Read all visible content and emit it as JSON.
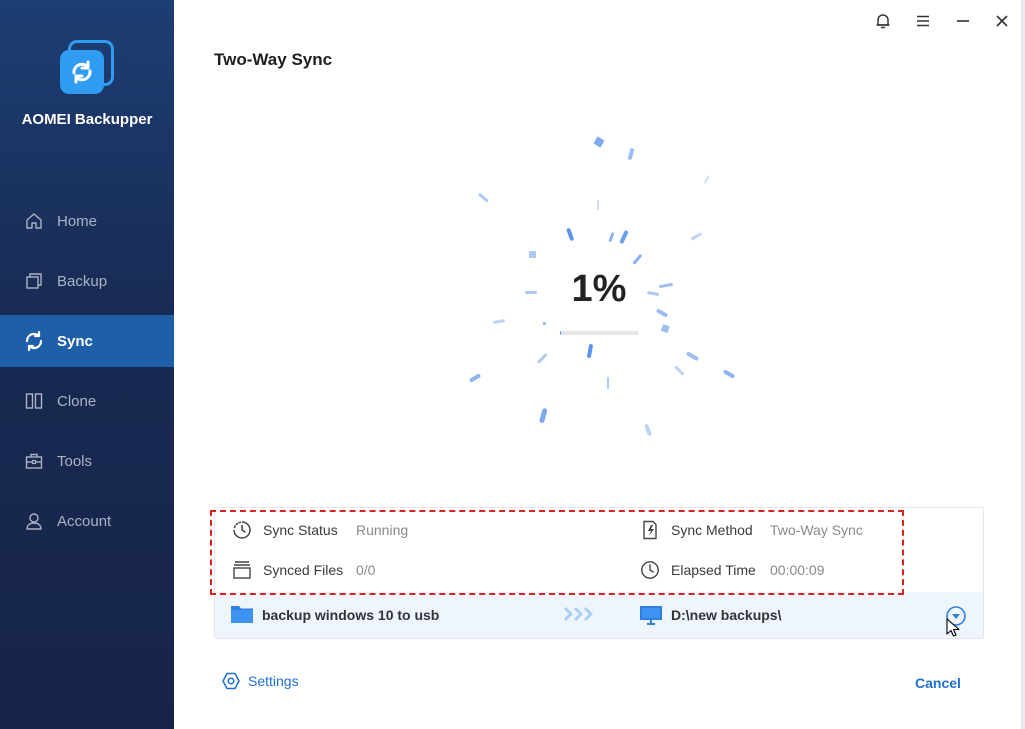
{
  "app": {
    "name": "AOMEI Backupper"
  },
  "sidebar": {
    "items": [
      {
        "label": "Home",
        "icon": "home-icon"
      },
      {
        "label": "Backup",
        "icon": "backup-icon"
      },
      {
        "label": "Sync",
        "icon": "sync-icon",
        "active": true
      },
      {
        "label": "Clone",
        "icon": "clone-icon"
      },
      {
        "label": "Tools",
        "icon": "tools-icon"
      },
      {
        "label": "Account",
        "icon": "account-icon"
      }
    ]
  },
  "titlebar": {
    "buttons": [
      "bell-icon",
      "menu-icon",
      "minimize-icon",
      "close-icon"
    ]
  },
  "page": {
    "title": "Two-Way Sync"
  },
  "progress": {
    "percent_label": "1%",
    "value": 0.01
  },
  "info": {
    "sync_status_label": "Sync Status",
    "sync_status_value": "Running",
    "synced_files_label": "Synced Files",
    "synced_files_value": "0/0",
    "sync_method_label": "Sync Method",
    "sync_method_value": "Two-Way Sync",
    "elapsed_time_label": "Elapsed Time",
    "elapsed_time_value": "00:00:09"
  },
  "task": {
    "name": "backup windows 10 to usb",
    "destination": "D:\\new backups\\"
  },
  "footer": {
    "settings_label": "Settings",
    "cancel_label": "Cancel"
  },
  "colors": {
    "sidebar_bg": "#182a52",
    "active_nav": "#1f5fa8",
    "accent": "#1f6fcf",
    "highlight": "#e02020"
  }
}
